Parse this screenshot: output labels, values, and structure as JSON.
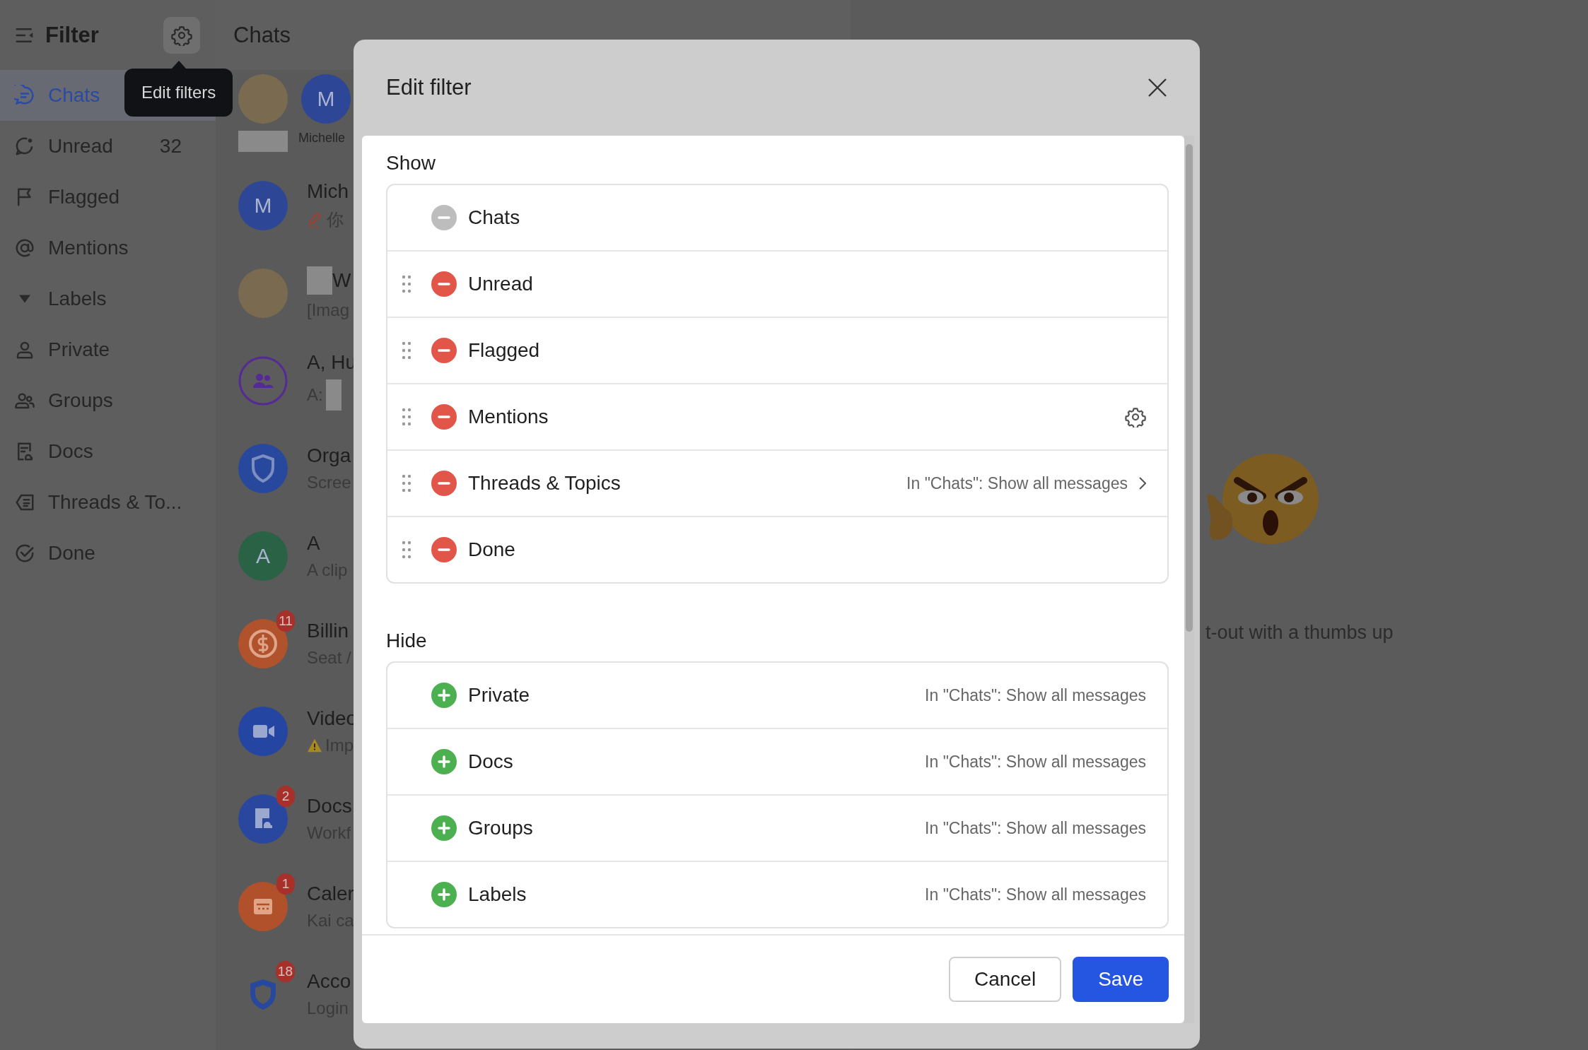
{
  "sidebar": {
    "title": "Filter",
    "tooltip": "Edit filters",
    "items": [
      {
        "label": "Chats",
        "selected": true
      },
      {
        "label": "Unread",
        "count": "32",
        "selected": false
      },
      {
        "label": "Flagged",
        "selected": false
      },
      {
        "label": "Mentions",
        "selected": false
      },
      {
        "label": "Labels",
        "selected": false
      },
      {
        "label": "Private",
        "selected": false
      },
      {
        "label": "Groups",
        "selected": false
      },
      {
        "label": "Docs",
        "selected": false
      },
      {
        "label": "Threads & To...",
        "selected": false
      },
      {
        "label": "Done",
        "selected": false
      }
    ]
  },
  "chat_list": {
    "title": "Chats",
    "pinned": [
      {
        "kind": "photo",
        "name_redacted": true
      },
      {
        "kind": "letter",
        "initial": "M",
        "color": "#2d4696",
        "name": "Michelle"
      }
    ],
    "chats": [
      {
        "kind": "letter",
        "initial": "M",
        "color": "#2d4696",
        "name": "Mich",
        "preview": "你"
      },
      {
        "kind": "photo",
        "name_redacted": true,
        "name": "W",
        "preview": "[Imag"
      },
      {
        "kind": "group",
        "color": "#552a96",
        "name": "A, Hu",
        "preview": "A:",
        "preview_redacted": true
      },
      {
        "kind": "shield",
        "color": "#27489c",
        "name": "Orga",
        "preview": "Scree"
      },
      {
        "kind": "letter",
        "initial": "A",
        "color": "#2a6246",
        "name": "A",
        "preview": "A clip"
      },
      {
        "kind": "dollar",
        "color": "#b0532d",
        "name": "Billin",
        "preview": "Seat /",
        "badge": "11"
      },
      {
        "kind": "video",
        "color": "#2445a2",
        "name": "Video",
        "preview": "Imp"
      },
      {
        "kind": "doc",
        "color": "#2a47a0",
        "name": "Docs",
        "preview": "Workf",
        "badge": "2"
      },
      {
        "kind": "calendar",
        "color": "#b0512b",
        "name": "Caler",
        "preview": "Kai ca",
        "badge": "1"
      },
      {
        "kind": "shield-outline",
        "color": "#27489c",
        "name": "Acco",
        "preview": "Login",
        "badge": "18"
      }
    ]
  },
  "main_pane": {
    "caption": "t-out with a thumbs up"
  },
  "dialog": {
    "title": "Edit filter",
    "sections": [
      {
        "heading": "Show",
        "items": [
          {
            "label": "Chats",
            "kind": "remove",
            "locked": true,
            "draggable": false
          },
          {
            "label": "Unread",
            "kind": "remove",
            "locked": false,
            "draggable": true
          },
          {
            "label": "Flagged",
            "kind": "remove",
            "locked": false,
            "draggable": true
          },
          {
            "label": "Mentions",
            "kind": "remove",
            "locked": false,
            "draggable": true,
            "settings": true
          },
          {
            "label": "Threads & Topics",
            "kind": "remove",
            "locked": false,
            "draggable": true,
            "detail": "In \"Chats\": Show all messages",
            "chevron": true
          },
          {
            "label": "Done",
            "kind": "remove",
            "locked": false,
            "draggable": true
          }
        ]
      },
      {
        "heading": "Hide",
        "items": [
          {
            "label": "Private",
            "kind": "add",
            "locked": false,
            "draggable": false,
            "detail": "In \"Chats\": Show all messages"
          },
          {
            "label": "Docs",
            "kind": "add",
            "locked": false,
            "draggable": false,
            "detail": "In \"Chats\": Show all messages"
          },
          {
            "label": "Groups",
            "kind": "add",
            "locked": false,
            "draggable": false,
            "detail": "In \"Chats\": Show all messages"
          },
          {
            "label": "Labels",
            "kind": "add",
            "locked": false,
            "draggable": false,
            "detail": "In \"Chats\": Show all messages"
          }
        ]
      }
    ],
    "buttons": [
      {
        "label": "Cancel",
        "kind": "secondary"
      },
      {
        "label": "Save",
        "kind": "primary"
      }
    ]
  }
}
